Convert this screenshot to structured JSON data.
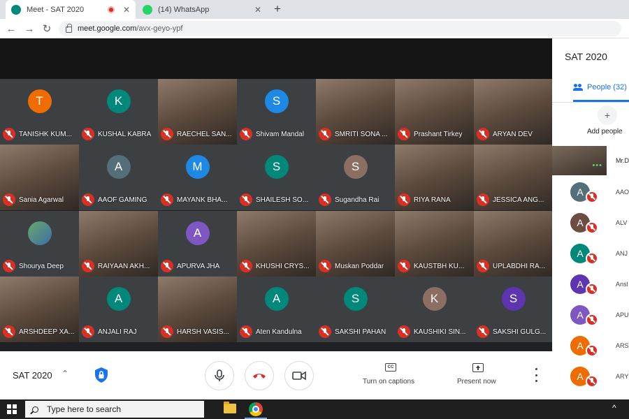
{
  "browser": {
    "tabs": [
      {
        "title": "Meet - SAT 2020",
        "favicon_color": "#00897b",
        "recording": true
      },
      {
        "title": "(14) WhatsApp",
        "favicon_color": "#25d366",
        "recording": false
      }
    ],
    "new_tab_label": "+",
    "url_domain": "meet.google.com",
    "url_path": "/avx-geyo-ypf"
  },
  "participants_grid": [
    {
      "name": "TANISHK KUM...",
      "initial": "T",
      "color": "#ef6c00",
      "video": false
    },
    {
      "name": "KUSHAL KABRA",
      "initial": "K",
      "color": "#00897b",
      "video": false
    },
    {
      "name": "RAECHEL SAN...",
      "initial": "",
      "color": "",
      "video": true
    },
    {
      "name": "Shivam Mandal",
      "initial": "S",
      "color": "#1e88e5",
      "video": false
    },
    {
      "name": "SMRITI SONA ...",
      "initial": "",
      "color": "",
      "video": true
    },
    {
      "name": "Prashant Tirkey",
      "initial": "",
      "color": "",
      "video": true
    },
    {
      "name": "ARYAN DEV",
      "initial": "",
      "color": "",
      "video": true
    },
    {
      "name": "Sania Agarwal",
      "initial": "",
      "color": "",
      "video": true
    },
    {
      "name": "AAOF GAMING",
      "initial": "A",
      "color": "#546e7a",
      "video": false
    },
    {
      "name": "MAYANK BHA...",
      "initial": "M",
      "color": "#1e88e5",
      "video": false
    },
    {
      "name": "SHAILESH SO...",
      "initial": "S",
      "color": "#00897b",
      "video": false
    },
    {
      "name": "Sugandha Rai",
      "initial": "S",
      "color": "#8d6e63",
      "video": false
    },
    {
      "name": "RIYA RANA",
      "initial": "",
      "color": "",
      "video": true
    },
    {
      "name": "JESSICA ANG...",
      "initial": "",
      "color": "",
      "video": true
    },
    {
      "name": "Shourya Deep",
      "initial": "",
      "color": "",
      "video": false,
      "photo": true
    },
    {
      "name": "RAIYAAN AKH...",
      "initial": "",
      "color": "",
      "video": true
    },
    {
      "name": "APURVA JHA",
      "initial": "A",
      "color": "#7e57c2",
      "video": false
    },
    {
      "name": "KHUSHI CRYS...",
      "initial": "",
      "color": "",
      "video": true
    },
    {
      "name": "Muskan Poddar",
      "initial": "",
      "color": "",
      "video": true
    },
    {
      "name": "KAUSTBH KU...",
      "initial": "",
      "color": "",
      "video": true
    },
    {
      "name": "UPLABDHI RA...",
      "initial": "",
      "color": "",
      "video": true
    },
    {
      "name": "ARSHDEEP XA...",
      "initial": "",
      "color": "",
      "video": true
    },
    {
      "name": "ANJALI RAJ",
      "initial": "A",
      "color": "#00897b",
      "video": false
    },
    {
      "name": "HARSH VASIS...",
      "initial": "",
      "color": "",
      "video": true
    },
    {
      "name": "Aten Kandulna",
      "initial": "A",
      "color": "#00897b",
      "video": false
    },
    {
      "name": "SAKSHI PAHAN",
      "initial": "S",
      "color": "#00897b",
      "video": false
    },
    {
      "name": "KAUSHIKI SIN...",
      "initial": "K",
      "color": "#8d6e63",
      "video": false
    },
    {
      "name": "SAKSHI GULG...",
      "initial": "S",
      "color": "#5e35b1",
      "video": false
    }
  ],
  "side_panel": {
    "title": "SAT 2020",
    "people_tab_label": "People (32)",
    "add_people_icon": "+",
    "add_people_label": "Add people",
    "self_name": "Mr.D",
    "self_indicator": "•••",
    "people": [
      {
        "initial": "A",
        "name": "AAO",
        "color": "#546e7a"
      },
      {
        "initial": "A",
        "name": "ALV",
        "color": "#6d4c41"
      },
      {
        "initial": "A",
        "name": "ANJ",
        "color": "#00897b"
      },
      {
        "initial": "A",
        "name": "Ansl",
        "color": "#5e35b1"
      },
      {
        "initial": "A",
        "name": "APU",
        "color": "#7e57c2"
      },
      {
        "initial": "A",
        "name": "ARS",
        "color": "#ef6c00"
      },
      {
        "initial": "A",
        "name": "ARY",
        "color": "#ef6c00"
      }
    ]
  },
  "controls": {
    "meeting_name": "SAT 2020",
    "chevron": "⌃",
    "captions_icon": "CC",
    "captions_label": "Turn on captions",
    "present_label": "Present now"
  },
  "taskbar": {
    "search_placeholder": "Type here to search",
    "tray_chevron": "^"
  }
}
